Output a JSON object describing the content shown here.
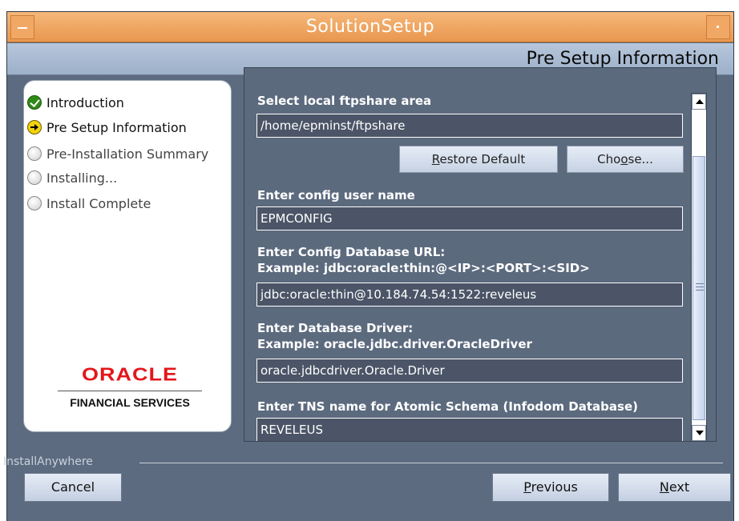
{
  "window": {
    "title": "SolutionSetup"
  },
  "header": {
    "step_title": "Pre Setup Information"
  },
  "steps": [
    {
      "label": "Introduction",
      "status": "complete",
      "icon": "check-icon"
    },
    {
      "label": "Pre Setup Information",
      "status": "current",
      "icon": "arrow-right-icon"
    },
    {
      "label": "Pre-Installation Summary",
      "status": "pending",
      "icon": "empty-circle-icon"
    },
    {
      "label": "Installing...",
      "status": "pending",
      "icon": "empty-circle-icon"
    },
    {
      "label": "Install Complete",
      "status": "pending",
      "icon": "empty-circle-icon"
    }
  ],
  "logo": {
    "brand": "ORACLE",
    "subtitle": "FINANCIAL SERVICES"
  },
  "form": {
    "ftpshare": {
      "label": "Select local ftpshare area",
      "value": "/home/epminst/ftpshare",
      "restore_default": {
        "pre": "",
        "mnemonic": "R",
        "post": "estore Default"
      },
      "choose": {
        "pre": "Cho",
        "mnemonic": "o",
        "post": "se..."
      }
    },
    "config_user": {
      "label": "Enter config user name",
      "value": "EPMCONFIG"
    },
    "config_db_url": {
      "label": "Enter Config Database URL:",
      "example": "Example: jdbc:oracle:thin:@<IP>:<PORT>:<SID>",
      "value": "jdbc:oracle:thin@10.184.74.54:1522:reveleus"
    },
    "db_driver": {
      "label": "Enter Database Driver:",
      "example": "Example: oracle.jdbc.driver.OracleDriver",
      "value": "oracle.jdbcdriver.Oracle.Driver"
    },
    "tns_name": {
      "label": "Enter TNS name for Atomic Schema (Infodom Database)",
      "value": "REVELEUS"
    }
  },
  "footer": {
    "vendor": "InstallAnywhere",
    "cancel": "Cancel",
    "previous": {
      "mnemonic": "P",
      "post": "revious"
    },
    "next": {
      "mnemonic": "N",
      "post": "ext"
    }
  },
  "colors": {
    "titlebar": "#e9974e",
    "panel": "#5c6a7e",
    "oracle_red": "#e3161b"
  }
}
